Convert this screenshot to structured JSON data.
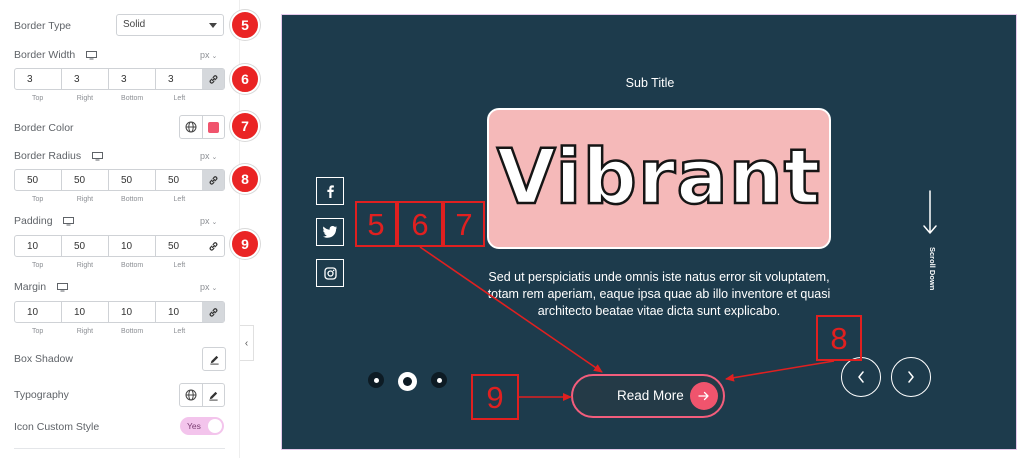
{
  "panel": {
    "border_type": {
      "label": "Border Type",
      "value": "Solid",
      "badge": "5"
    },
    "border_width": {
      "label": "Border Width",
      "unit": "px",
      "values": [
        "3",
        "3",
        "3",
        "3"
      ],
      "badge": "6"
    },
    "border_color": {
      "label": "Border Color",
      "badge": "7",
      "swatch_color": "#f0546d"
    },
    "border_radius": {
      "label": "Border Radius",
      "unit": "px",
      "values": [
        "50",
        "50",
        "50",
        "50"
      ],
      "badge": "8"
    },
    "padding": {
      "label": "Padding",
      "unit": "px",
      "values": [
        "10",
        "50",
        "10",
        "50"
      ],
      "badge": "9"
    },
    "margin": {
      "label": "Margin",
      "unit": "px",
      "values": [
        "10",
        "10",
        "10",
        "10"
      ]
    },
    "sides": [
      "Top",
      "Right",
      "Bottom",
      "Left"
    ],
    "box_shadow": {
      "label": "Box Shadow"
    },
    "typography": {
      "label": "Typography"
    },
    "icon_custom_style": {
      "label": "Icon Custom Style",
      "toggle": "Yes"
    }
  },
  "preview": {
    "subtitle": "Sub Title",
    "title": "Vibrant",
    "description": "Sed ut perspiciatis unde omnis iste natus error sit voluptatem, totam rem aperiam, eaque ipsa quae ab illo inventore et quasi architecto beatae vitae dicta sunt explicabo.",
    "button_label": "Read More",
    "scroll_label": "Scroll Down",
    "social_icons": [
      "facebook-icon",
      "twitter-icon",
      "instagram-icon"
    ],
    "colors": {
      "background": "#1d3b4c",
      "accent": "#f0546d",
      "title_box": "#f5b9b9"
    }
  },
  "annotations": {
    "box_5": "5",
    "box_6": "6",
    "box_7": "7",
    "box_8": "8",
    "box_9": "9",
    "color": "#e02020"
  }
}
